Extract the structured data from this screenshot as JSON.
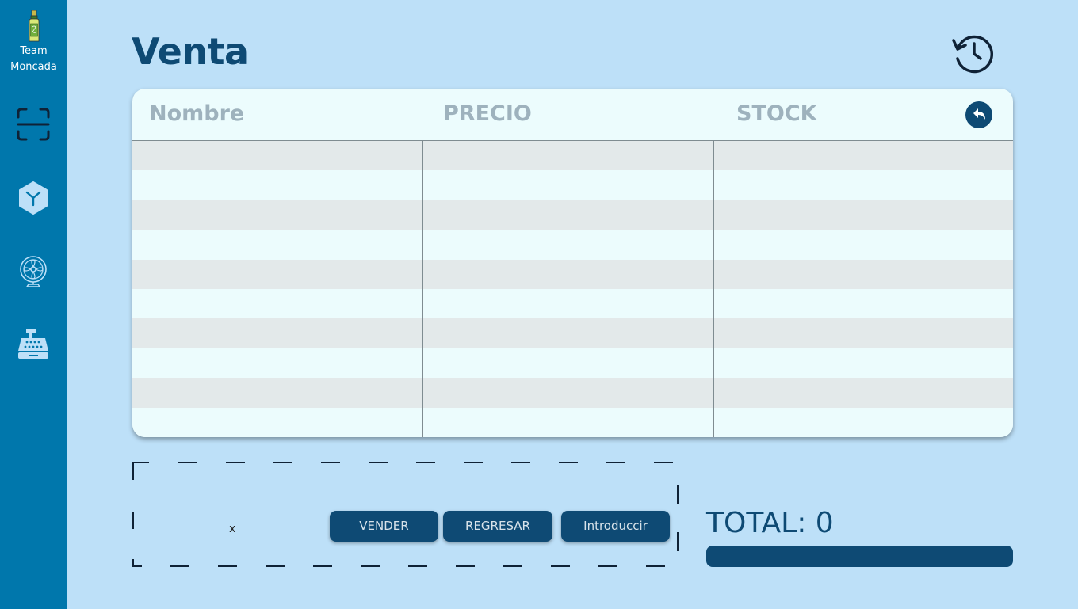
{
  "brand": {
    "line1": "Team",
    "line2": "Moncada"
  },
  "sidebar": {
    "items": [
      {
        "icon": "scan-icon"
      },
      {
        "icon": "package-icon"
      },
      {
        "icon": "fan-icon"
      },
      {
        "icon": "cash-register-icon"
      }
    ]
  },
  "header": {
    "title": "Venta",
    "history_icon": "history-icon"
  },
  "table": {
    "columns": [
      "Nombre",
      "PRECIO",
      "STOCK"
    ],
    "back_icon": "undo-icon",
    "rows": []
  },
  "entry": {
    "qty_value": "",
    "times_sign": "x",
    "amount_value": ""
  },
  "actions": {
    "sell_label": "VENDER",
    "return_label": "REGRESAR",
    "enter_label": "Introduccir"
  },
  "total": {
    "label": "TOTAL: 0"
  },
  "colors": {
    "background": "#bde0f8",
    "sidebar": "#0077ac",
    "accent": "#0e4a74",
    "table_bg": "#ecfcfd",
    "row_alt": "#e3e9ea",
    "header_text": "#9eb2bd"
  }
}
